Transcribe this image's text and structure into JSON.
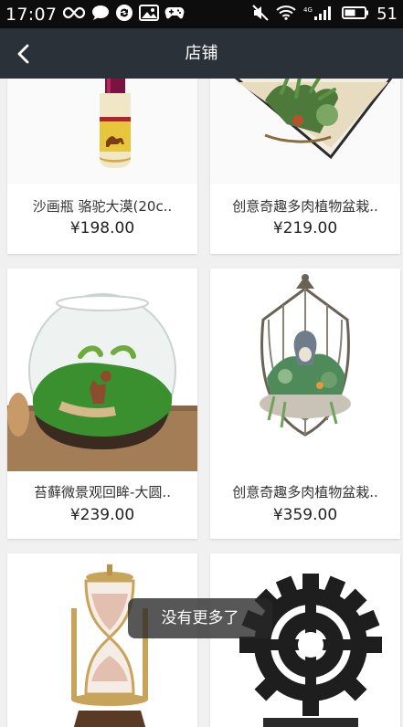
{
  "status_bar": {
    "time": "17:07",
    "battery_level": "51"
  },
  "header": {
    "title": "店铺"
  },
  "products": [
    {
      "name": "沙画瓶 骆驼大漠(20c..",
      "price": "¥198.00"
    },
    {
      "name": "创意奇趣多肉植物盆栽..",
      "price": "¥219.00"
    },
    {
      "name": "苔藓微景观回眸-大圆..",
      "price": "¥239.00"
    },
    {
      "name": "创意奇趣多肉植物盆栽..",
      "price": "¥359.00"
    }
  ],
  "toast": {
    "message": "没有更多了"
  },
  "colors": {
    "status_bar_bg": "#0d0d0d",
    "app_bar_bg": "#2b3138",
    "page_bg": "#f0f0f0",
    "card_bg": "#ffffff"
  }
}
